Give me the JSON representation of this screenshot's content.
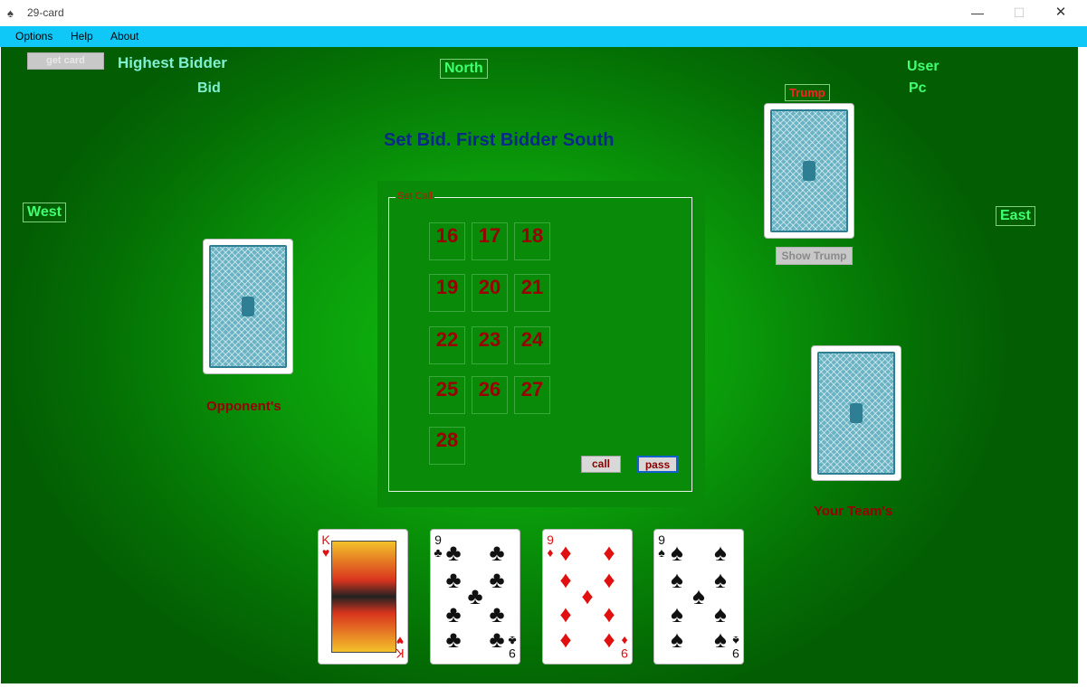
{
  "window": {
    "title": "29-card",
    "min": "—",
    "max": "☐",
    "close": "✕"
  },
  "menu": [
    "Options",
    "Help",
    "About"
  ],
  "top": {
    "get_card": "get card",
    "highest_bidder": "Highest Bidder",
    "bid": "Bid",
    "north": "North",
    "user": "User",
    "pc": "Pc",
    "trump": "Trump",
    "status": "Set Bid. First Bidder South"
  },
  "sides": {
    "west": "West",
    "east": "East",
    "show_trump": "Show Trump",
    "opponents": "Opponent's",
    "your_team": "Your Team's"
  },
  "bid_panel": {
    "legend": "Set Call",
    "numbers": [
      "16",
      "17",
      "18",
      "19",
      "20",
      "21",
      "22",
      "23",
      "24",
      "25",
      "26",
      "27",
      "28"
    ],
    "call": "call",
    "pass": "pass"
  },
  "hand": [
    {
      "rank": "K",
      "suit": "♥",
      "color": "red"
    },
    {
      "rank": "9",
      "suit": "♣",
      "color": "black"
    },
    {
      "rank": "9",
      "suit": "♦",
      "color": "red"
    },
    {
      "rank": "9",
      "suit": "♠",
      "color": "black"
    }
  ],
  "colors": {
    "menubar": "#10c8f8",
    "felt": "#0a9a0a",
    "bid_text": "#9a0000",
    "status": "#0a2a8a"
  }
}
